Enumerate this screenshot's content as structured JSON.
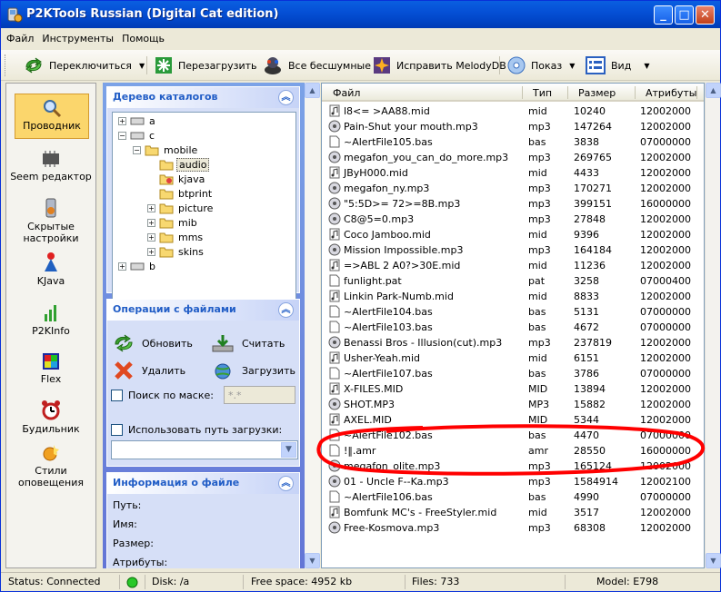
{
  "window": {
    "title": "P2KTools Russian (Digital Cat edition)"
  },
  "menu": [
    "Файл",
    "Инструменты",
    "Помощь"
  ],
  "toolbar": {
    "switch_label": "Переключиться",
    "restart_label": "Перезагрузить",
    "all_silent_label": "Все бесшумные",
    "fix_melody_label": "Исправить MelodyDB",
    "show_label": "Показ",
    "view_label": "Вид"
  },
  "leftbar": [
    {
      "label": "Проводник"
    },
    {
      "label": "Seem редактор"
    },
    {
      "label": "Скрытые настройки"
    },
    {
      "label": "KJava"
    },
    {
      "label": "P2KInfo"
    },
    {
      "label": "Flex"
    },
    {
      "label": "Будильник"
    },
    {
      "label": "Стили оповещения"
    }
  ],
  "tree_panel": {
    "title": "Дерево каталогов",
    "nodes": [
      "a",
      "c",
      "mobile",
      "audio",
      "kjava",
      "btprint",
      "picture",
      "mib",
      "mms",
      "skins",
      "b"
    ]
  },
  "ops_panel": {
    "title": "Операции с файлами",
    "refresh": "Обновить",
    "read": "Считать",
    "delete": "Удалить",
    "upload": "Загрузить",
    "mask_label": "Поиск по маске:",
    "mask_value": "*.*",
    "use_path_label": "Использовать путь загрузки:"
  },
  "info_panel": {
    "title": "Информация о файле",
    "fields": [
      "Путь:",
      "Имя:",
      "Размер:",
      "Атрибуты:"
    ]
  },
  "columns": [
    "Файл",
    "Тип",
    "Размер",
    "Атрибуты"
  ],
  "files": [
    {
      "name": "l8<= >AA88.mid",
      "type": "mid",
      "size": "10240",
      "attr": "12002000",
      "icon": "midi-file-icon"
    },
    {
      "name": "Pain-Shut your mouth.mp3",
      "type": "mp3",
      "size": "147264",
      "attr": "12002000",
      "icon": "mp3-file-icon"
    },
    {
      "name": "~AlertFile105.bas",
      "type": "bas",
      "size": "3838",
      "attr": "07000000",
      "icon": "file-icon"
    },
    {
      "name": "megafon_you_can_do_more.mp3",
      "type": "mp3",
      "size": "269765",
      "attr": "12002000",
      "icon": "mp3-file-icon"
    },
    {
      "name": "JByH000.mid",
      "type": "mid",
      "size": "4433",
      "attr": "12002000",
      "icon": "midi-file-icon"
    },
    {
      "name": "megafon_ny.mp3",
      "type": "mp3",
      "size": "170271",
      "attr": "12002000",
      "icon": "mp3-file-icon"
    },
    {
      "name": "\"5:5D>= 72>=8B.mp3",
      "type": "mp3",
      "size": "399151",
      "attr": "16000000",
      "icon": "mp3-file-icon"
    },
    {
      "name": "C8@5=0.mp3",
      "type": "mp3",
      "size": "27848",
      "attr": "12002000",
      "icon": "mp3-file-icon"
    },
    {
      "name": "Coco Jamboo.mid",
      "type": "mid",
      "size": "9396",
      "attr": "12002000",
      "icon": "midi-file-icon"
    },
    {
      "name": "Mission Impossible.mp3",
      "type": "mp3",
      "size": "164184",
      "attr": "12002000",
      "icon": "mp3-file-icon"
    },
    {
      "name": "=>ABL 2 A0?>30E.mid",
      "type": "mid",
      "size": "11236",
      "attr": "12002000",
      "icon": "midi-file-icon"
    },
    {
      "name": "funlight.pat",
      "type": "pat",
      "size": "3258",
      "attr": "07000400",
      "icon": "file-icon"
    },
    {
      "name": "Linkin Park-Numb.mid",
      "type": "mid",
      "size": "8833",
      "attr": "12002000",
      "icon": "midi-file-icon"
    },
    {
      "name": "~AlertFile104.bas",
      "type": "bas",
      "size": "5131",
      "attr": "07000000",
      "icon": "file-icon"
    },
    {
      "name": "~AlertFile103.bas",
      "type": "bas",
      "size": "4672",
      "attr": "07000000",
      "icon": "file-icon"
    },
    {
      "name": "Benassi Bros - Illusion(cut).mp3",
      "type": "mp3",
      "size": "237819",
      "attr": "12002000",
      "icon": "mp3-file-icon"
    },
    {
      "name": "Usher-Yeah.mid",
      "type": "mid",
      "size": "6151",
      "attr": "12002000",
      "icon": "midi-file-icon"
    },
    {
      "name": "~AlertFile107.bas",
      "type": "bas",
      "size": "3786",
      "attr": "07000000",
      "icon": "file-icon"
    },
    {
      "name": "X-FILES.MID",
      "type": "MID",
      "size": "13894",
      "attr": "12002000",
      "icon": "midi-file-icon"
    },
    {
      "name": "SHOT.MP3",
      "type": "MP3",
      "size": "15882",
      "attr": "12002000",
      "icon": "mp3-file-icon"
    },
    {
      "name": "AXEL.MID",
      "type": "MID",
      "size": "5344",
      "attr": "12002000",
      "icon": "midi-file-icon"
    },
    {
      "name": "~AlertFile102.bas",
      "type": "bas",
      "size": "4470",
      "attr": "07000000",
      "icon": "file-icon"
    },
    {
      "name": "!‖.amr",
      "type": "amr",
      "size": "28550",
      "attr": "16000000",
      "icon": "file-icon"
    },
    {
      "name": "megafon_olite.mp3",
      "type": "mp3",
      "size": "165124",
      "attr": "12002000",
      "icon": "mp3-file-icon"
    },
    {
      "name": "01 - Uncle F--Ka.mp3",
      "type": "mp3",
      "size": "1584914",
      "attr": "12002100",
      "icon": "mp3-file-icon"
    },
    {
      "name": "~AlertFile106.bas",
      "type": "bas",
      "size": "4990",
      "attr": "07000000",
      "icon": "file-icon"
    },
    {
      "name": "Bomfunk MC's - FreeStyler.mid",
      "type": "mid",
      "size": "3517",
      "attr": "12002000",
      "icon": "midi-file-icon"
    },
    {
      "name": "Free-Kosmova.mp3",
      "type": "mp3",
      "size": "68308",
      "attr": "12002000",
      "icon": "mp3-file-icon"
    }
  ],
  "status": {
    "status": "Status: Connected",
    "disk": "Disk: /a",
    "free": "Free space: 4952 kb",
    "files": "Files: 733",
    "model": "Model: E798"
  }
}
